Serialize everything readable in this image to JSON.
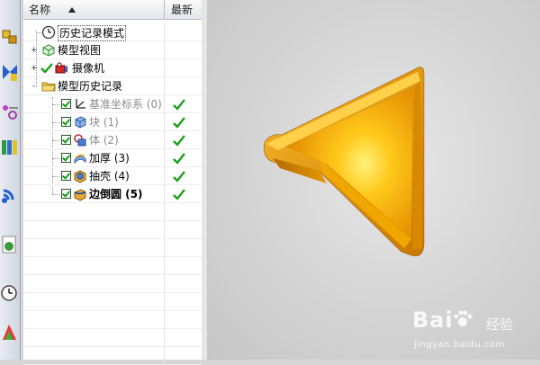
{
  "navigator": {
    "columns": {
      "name": "名称",
      "latest": "最新"
    },
    "rows": [
      {
        "label": "历史记录模式",
        "level": 0,
        "icon": "clock-icon",
        "expand": "",
        "check": false,
        "dim": false,
        "bold": false,
        "latest": false,
        "selected": true
      },
      {
        "label": "模型视图",
        "level": 0,
        "icon": "model-views-icon",
        "expand": "+",
        "check": false,
        "dim": false,
        "bold": false,
        "latest": false,
        "selected": false
      },
      {
        "label": "摄像机",
        "level": 0,
        "icon": "camera-icon",
        "expand": "+",
        "check": false,
        "dim": false,
        "bold": false,
        "latest": false,
        "selected": false
      },
      {
        "label": "模型历史记录",
        "level": 0,
        "icon": "folder-icon",
        "expand": "-",
        "check": false,
        "dim": false,
        "bold": false,
        "latest": false,
        "selected": false
      },
      {
        "label": "基准坐标系 (0)",
        "level": 1,
        "icon": "datum-csys-icon",
        "expand": "",
        "check": true,
        "dim": true,
        "bold": false,
        "latest": true,
        "selected": false
      },
      {
        "label": "块 (1)",
        "level": 1,
        "icon": "block-icon",
        "expand": "",
        "check": true,
        "dim": true,
        "bold": false,
        "latest": true,
        "selected": false
      },
      {
        "label": "体 (2)",
        "level": 1,
        "icon": "body-icon",
        "expand": "",
        "check": true,
        "dim": true,
        "bold": false,
        "latest": true,
        "selected": false
      },
      {
        "label": "加厚 (3)",
        "level": 1,
        "icon": "thicken-icon",
        "expand": "",
        "check": true,
        "dim": false,
        "bold": false,
        "latest": true,
        "selected": false
      },
      {
        "label": "抽壳 (4)",
        "level": 1,
        "icon": "shell-icon",
        "expand": "",
        "check": true,
        "dim": false,
        "bold": false,
        "latest": true,
        "selected": false
      },
      {
        "label": "边倒圆 (5)",
        "level": 1,
        "icon": "edge-blend-icon",
        "expand": "",
        "check": true,
        "dim": false,
        "bold": true,
        "latest": true,
        "selected": false
      }
    ]
  },
  "resource_bar": {
    "icons": [
      "assembly-navigator-icon",
      "constraint-navigator-icon",
      "part-navigator-icon",
      "reuse-library-icon",
      "web-browser-icon",
      "history-icon",
      "system-materials-icon",
      "process-studio-icon"
    ]
  },
  "viewport": {
    "model_color": "#f2a400",
    "background": "#d4d4d4"
  },
  "watermark": {
    "logo": "Bai",
    "paw": "paw-icon",
    "cn": "经验",
    "url": "jingyan.baidu.com"
  }
}
